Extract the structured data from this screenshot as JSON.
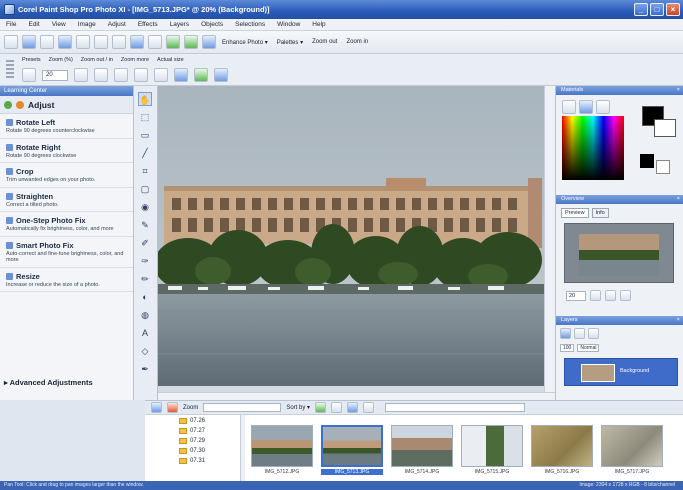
{
  "window": {
    "title": "Corel Paint Shop Pro Photo XI - [IMG_5713.JPG* @ 20% (Background)]",
    "controls": [
      "_",
      "□",
      "×"
    ]
  },
  "menu": [
    "File",
    "Edit",
    "View",
    "Image",
    "Adjust",
    "Effects",
    "Layers",
    "Objects",
    "Selections",
    "Window",
    "Help"
  ],
  "toolbar": {
    "enhance_photo": "Enhance Photo ▾",
    "palettes": "Palettes ▾",
    "zoom_out": "Zoom out",
    "zoom_in": "Zoom in"
  },
  "options_bar": {
    "labels": [
      "Presets",
      "Zoom (%)",
      "Zoom out / in",
      "Zoom more",
      "Actual size"
    ],
    "zoom_value": "20"
  },
  "learning_center": {
    "panel_title": "Learning Center",
    "section": "Adjust",
    "items": [
      {
        "title": "Rotate Left",
        "desc": "Rotate 90 degrees counterclockwise"
      },
      {
        "title": "Rotate Right",
        "desc": "Rotate 90 degrees clockwise"
      },
      {
        "title": "Crop",
        "desc": "Trim unwanted edges on your photo."
      },
      {
        "title": "Straighten",
        "desc": "Correct a tilted photo."
      },
      {
        "title": "One-Step Photo Fix",
        "desc": "Automatically fix brightness, color, and more"
      },
      {
        "title": "Smart Photo Fix",
        "desc": "Auto-correct and fine-tune brightness, color, and more"
      },
      {
        "title": "Resize",
        "desc": "Increase or reduce the size of a photo."
      }
    ],
    "advanced": "▸ Advanced Adjustments"
  },
  "right_panels": {
    "materials": "Materials",
    "overview": "Overview",
    "overview_tabs": [
      "Preview",
      "Info"
    ],
    "layers": "Layers",
    "layer_name": "Background",
    "layer_opacity": "100",
    "layer_blend": "Normal"
  },
  "organizer": {
    "zoom_label": "Zoom",
    "sort_label": "Sort by ▾",
    "folders": [
      "07.26",
      "07.27",
      "07.29",
      "07.30",
      "07.31"
    ],
    "thumbnails": [
      "IMG_5712.JPG",
      "IMG_5713.JPG",
      "IMG_5714.JPG",
      "IMG_5715.JPG",
      "IMG_5716.JPG",
      "IMG_5717.JPG"
    ],
    "selected_index": 1
  },
  "status": {
    "left": "Pan Tool: Click and drag to pan images larger than the window.",
    "right": "Image: 2304 x 1728 x RGB - 8 bits/channel"
  },
  "colors": {
    "title_blue": "#2a5bb8",
    "panel_header_blue": "#4a76c6",
    "selection_blue": "#3d6fd1"
  }
}
